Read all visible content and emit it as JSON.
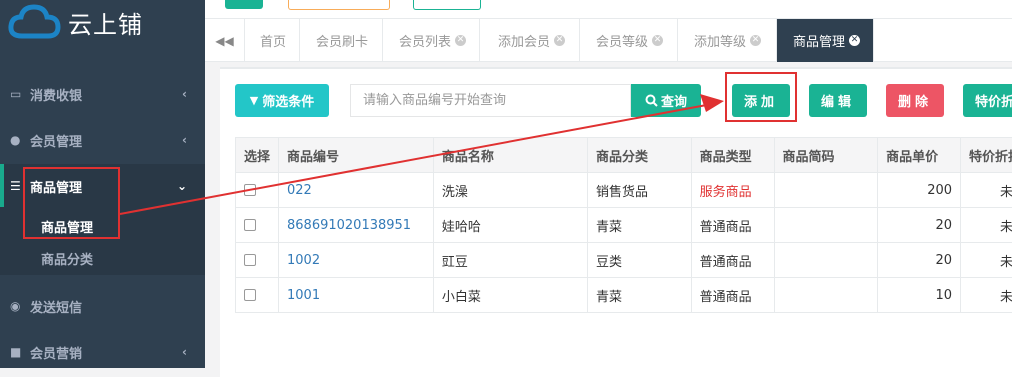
{
  "app": {
    "logo_text": "云上铺"
  },
  "sidebar": {
    "items": [
      {
        "label": "消费收银",
        "icon": "card-icon"
      },
      {
        "label": "会员管理",
        "icon": "user-icon"
      },
      {
        "label": "商品管理",
        "icon": "list-icon"
      },
      {
        "label": "发送短信",
        "icon": "chat-icon"
      },
      {
        "label": "会员营销",
        "icon": "briefcase-icon"
      }
    ],
    "submenu": [
      {
        "label": "商品管理"
      },
      {
        "label": "商品分类"
      }
    ]
  },
  "tabs": [
    {
      "label": "首页"
    },
    {
      "label": "会员刷卡"
    },
    {
      "label": "会员列表"
    },
    {
      "label": "添加会员"
    },
    {
      "label": "会员等级"
    },
    {
      "label": "添加等级"
    },
    {
      "label": "商品管理"
    }
  ],
  "toolbar": {
    "filter_label": "筛选条件",
    "search_placeholder": "请输入商品编号开始查询",
    "query_label": "查询",
    "add_label": "添加",
    "edit_label": "编辑",
    "delete_label": "删除",
    "special_label": "特价折"
  },
  "table": {
    "headers": [
      "选择",
      "商品编号",
      "商品名称",
      "商品分类",
      "商品类型",
      "商品简码",
      "商品单价",
      "特价折扣"
    ],
    "rows": [
      {
        "code": "022",
        "name": "洗澡",
        "category": "销售货品",
        "type": "服务商品",
        "short": "",
        "price": "200",
        "special": "未开"
      },
      {
        "code": "868691020138951",
        "name": "娃哈哈",
        "category": "青菜",
        "type": "普通商品",
        "short": "",
        "price": "20",
        "special": "未开"
      },
      {
        "code": "1002",
        "name": "豇豆",
        "category": "豆类",
        "type": "普通商品",
        "short": "",
        "price": "20",
        "special": "未开"
      },
      {
        "code": "1001",
        "name": "小白菜",
        "category": "青菜",
        "type": "普通商品",
        "short": "",
        "price": "10",
        "special": "未开"
      }
    ]
  },
  "colors": {
    "sidebar": "#2f4050",
    "primary": "#1ab394",
    "danger": "#ed5565",
    "info": "#23c6c8",
    "annotation": "#e03131"
  }
}
